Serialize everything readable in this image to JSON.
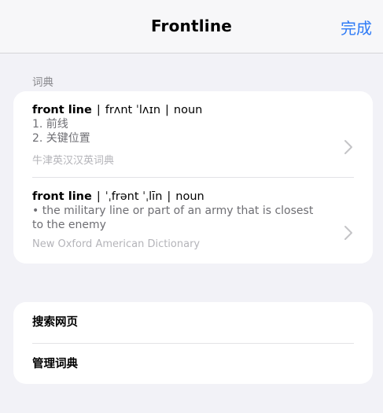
{
  "navbar": {
    "title": "Frontline",
    "done_label": "完成"
  },
  "dictionary_section": {
    "header": "词典",
    "entries": [
      {
        "headword": "front line",
        "pronunciation": "frʌnt ˈlʌɪn",
        "part_of_speech": "noun",
        "definitions": [
          "1. 前线",
          "2. 关键位置"
        ],
        "source": "牛津英汉汉英词典",
        "icon": "chevron-right-icon"
      },
      {
        "headword": "front line",
        "pronunciation": "ˈˌfrənt ˈˌlīn",
        "part_of_speech": "noun",
        "definitions": [
          "• the military line or part of an army that is closest to the enemy"
        ],
        "source": "New Oxford American Dictionary",
        "icon": "chevron-right-icon"
      }
    ]
  },
  "actions": {
    "search_web": "搜索网页",
    "manage_dictionaries": "管理词典"
  },
  "colors": {
    "accent": "#2f7bf6",
    "background": "#f2f2f7",
    "secondary_text": "#6e6e73",
    "tertiary_text": "#b4b4b9"
  }
}
